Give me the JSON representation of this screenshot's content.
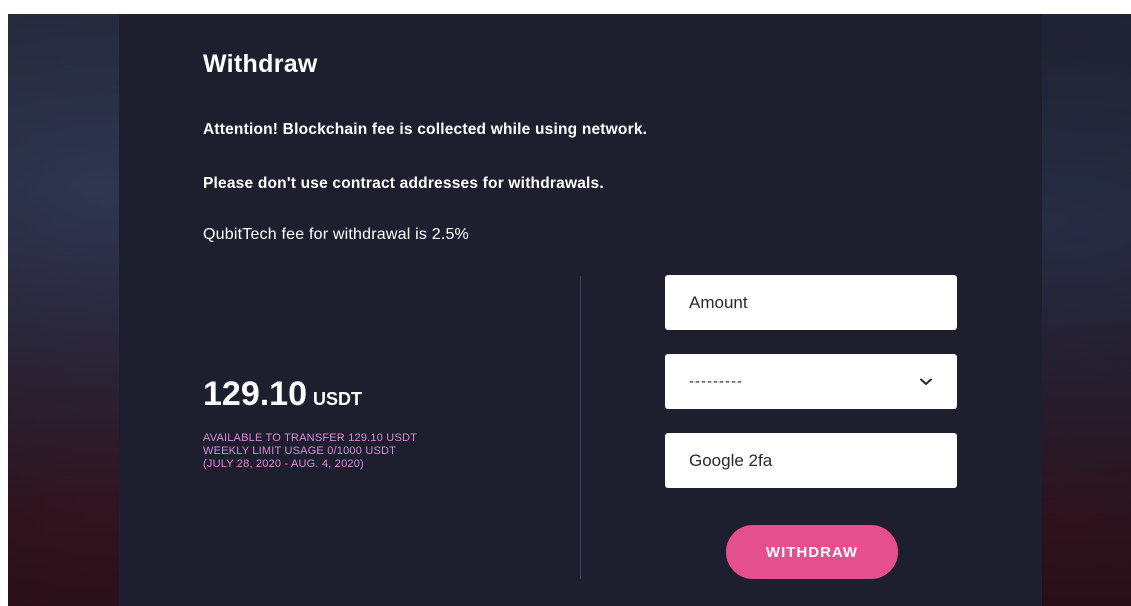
{
  "withdraw": {
    "title": "Withdraw",
    "notice_fee": "Attention! Blockchain fee is collected while using network.",
    "notice_contract": "Please don't use contract addresses for withdrawals.",
    "platform_fee": "QubitTech fee for withdrawal is 2.5%",
    "balance": {
      "amount": "129.10",
      "currency": "USDT",
      "available": "AVAILABLE TO TRANSFER 129.10 USDT",
      "weekly_limit": "WEEKLY LIMIT USAGE 0/1000 USDT",
      "period": "(JULY 28, 2020 - AUG. 4, 2020)"
    },
    "form": {
      "amount_placeholder": "Amount",
      "network_selected": "---------",
      "twofa_placeholder": "Google 2fa",
      "submit_label": "WITHDRAW"
    }
  },
  "icons": {
    "select_arrow": "chevron-down-icon"
  },
  "colors": {
    "panel_background": "#1d1f2e",
    "accent": "#e64f8d",
    "limit_text": "#d98ad8"
  }
}
